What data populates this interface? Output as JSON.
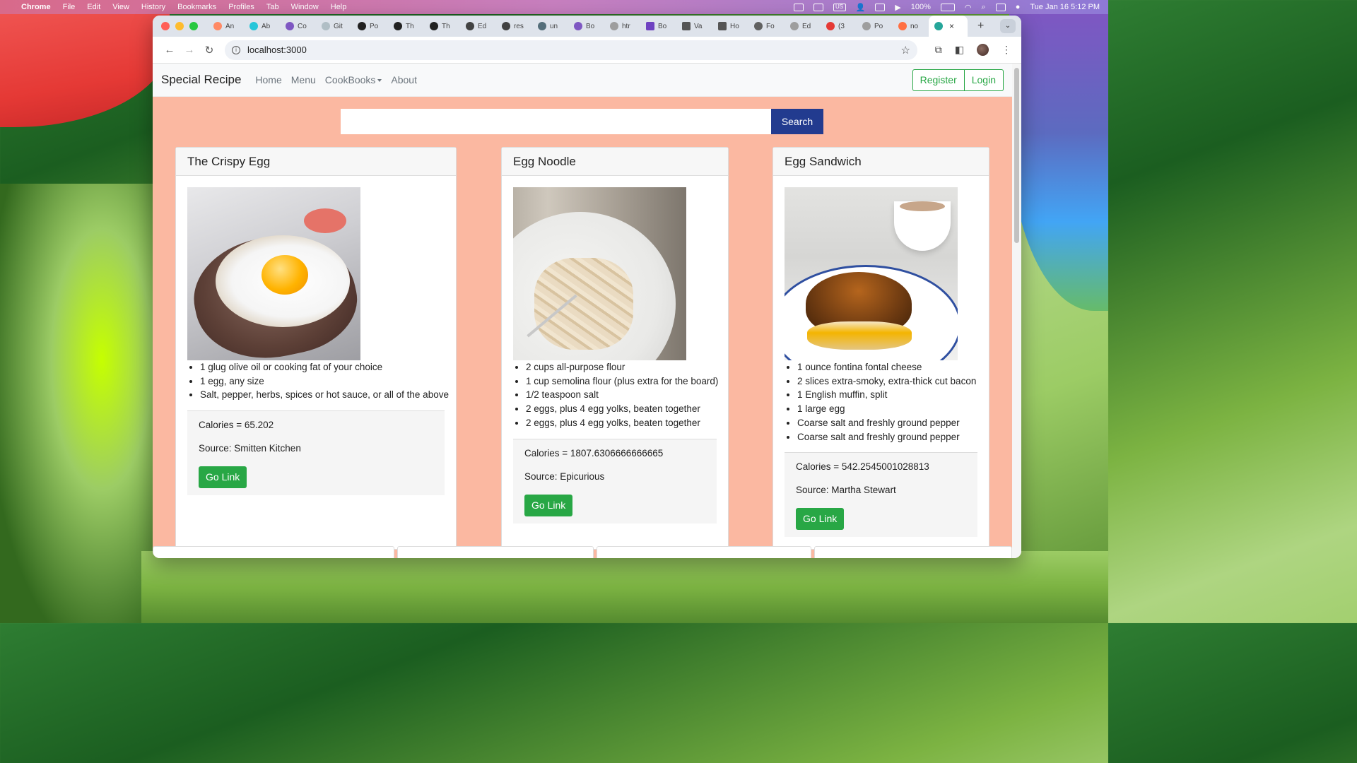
{
  "menubar": {
    "items": [
      "Chrome",
      "File",
      "Edit",
      "View",
      "History",
      "Bookmarks",
      "Profiles",
      "Tab",
      "Window",
      "Help"
    ],
    "battery": "100%",
    "datetime": "Tue Jan 16  5:12 PM",
    "input_source": "US"
  },
  "browser": {
    "tabs": [
      "An",
      "Ab",
      "Co",
      "Git",
      "Po",
      "Th",
      "Th",
      "Ed",
      "res",
      "un",
      "Bo",
      "htr",
      "Bo",
      "Va",
      "Ho",
      "Fo",
      "Ed",
      "(3",
      "Po",
      "no"
    ],
    "active_tab_close": "×",
    "new_tab": "+",
    "address": "localhost:3000"
  },
  "navbar": {
    "brand": "Special Recipe",
    "links": [
      "Home",
      "Menu",
      "CookBooks",
      "About"
    ],
    "register": "Register",
    "login": "Login"
  },
  "search": {
    "value": "",
    "button": "Search"
  },
  "recipes": [
    {
      "title": "The Crispy Egg",
      "ingredients": [
        "1 glug olive oil or cooking fat of your choice",
        "1 egg, any size",
        "Salt, pepper, herbs, spices or hot sauce, or all of the above"
      ],
      "calories": "Calories = 65.202",
      "source": "Source: Smitten Kitchen",
      "button": "Go Link"
    },
    {
      "title": "Egg Noodle",
      "ingredients": [
        "2 cups all-purpose flour",
        "1 cup semolina flour (plus extra for the board)",
        "1/2 teaspoon salt",
        "2 eggs, plus 4 egg yolks, beaten together",
        "2 eggs, plus 4 egg yolks, beaten together"
      ],
      "calories": "Calories = 1807.6306666666665",
      "source": "Source: Epicurious",
      "button": "Go Link"
    },
    {
      "title": "Egg Sandwich",
      "ingredients": [
        "1 ounce fontina fontal cheese",
        "2 slices extra-smoky, extra-thick cut bacon",
        "1 English muffin, split",
        "1 large egg",
        "Coarse salt and freshly ground pepper",
        "Coarse salt and freshly ground pepper"
      ],
      "calories": "Calories = 542.2545001028813",
      "source": "Source: Martha Stewart",
      "button": "Go Link"
    }
  ],
  "colors": {
    "page_bg": "#fbb8a1",
    "primary_btn": "#223b8f",
    "success": "#28a745"
  }
}
